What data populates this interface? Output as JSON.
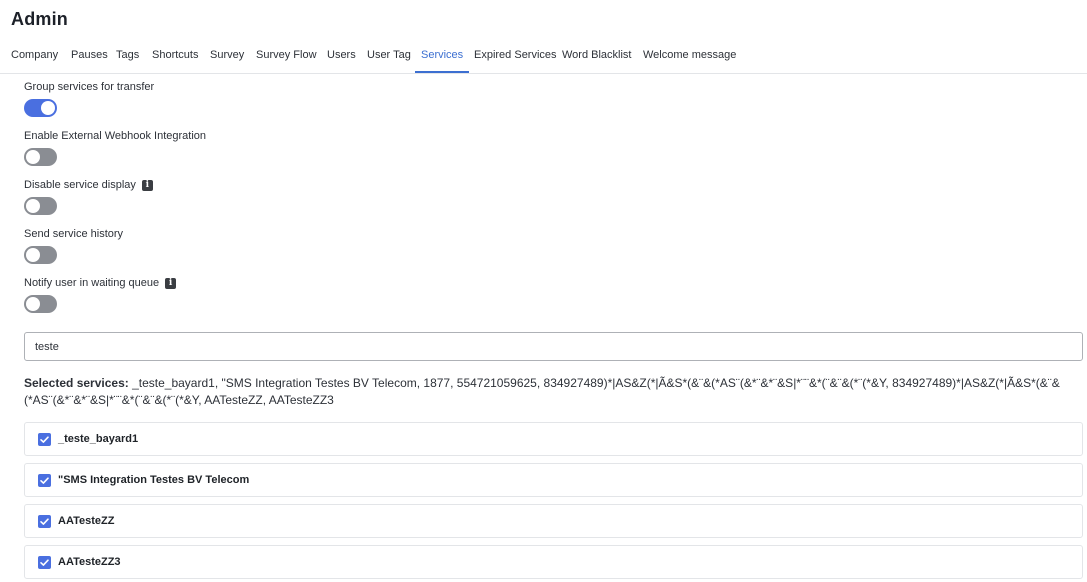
{
  "page": {
    "title": "Admin"
  },
  "tabs": [
    {
      "label": "Company"
    },
    {
      "label": "Pauses"
    },
    {
      "label": "Tags"
    },
    {
      "label": "Shortcuts"
    },
    {
      "label": "Survey"
    },
    {
      "label": "Survey Flow"
    },
    {
      "label": "Users"
    },
    {
      "label": "User Tag"
    },
    {
      "label": "Services",
      "active": true
    },
    {
      "label": "Expired Services"
    },
    {
      "label": "Word Blacklist"
    },
    {
      "label": "Welcome message"
    }
  ],
  "settings": {
    "group_transfer": {
      "label": "Group services for transfer",
      "enabled": true
    },
    "external_webhook": {
      "label": "Enable External Webhook Integration",
      "enabled": false
    },
    "disable_display": {
      "label": "Disable service display",
      "enabled": false,
      "info_icon": "info-icon"
    },
    "send_history": {
      "label": "Send service history",
      "enabled": false
    },
    "notify_queue": {
      "label": "Notify user in waiting queue",
      "enabled": false,
      "info_icon": "info-icon"
    }
  },
  "search": {
    "value": "teste",
    "placeholder": ""
  },
  "selected_services": {
    "label": "Selected services:",
    "value": "_teste_bayard1, \"SMS Integration Testes BV Telecom, 1877, 554721059625, 834927489)*|AS&Z(*|Ã&S*(&¨&(*AS¨(&*¨&*¨&S|*¨¨&*(¨&¨&(*¨(*&Y, 834927489)*|AS&Z(*|Ã&S*(&¨&(*AS¨(&*¨&*¨&S|*¨¨&*(¨&¨&(*¨(*&Y, AATesteZZ, AATesteZZ3"
  },
  "services": [
    {
      "name": "_teste_bayard1",
      "checked": true
    },
    {
      "name": "\"SMS Integration Testes BV Telecom",
      "checked": true
    },
    {
      "name": "AATesteZZ",
      "checked": true
    },
    {
      "name": "AATesteZZ3",
      "checked": true
    }
  ],
  "colors": {
    "accent": "#4a6fe0",
    "tab_active": "#3c6fd1",
    "toggle_off": "#8a8d93"
  }
}
